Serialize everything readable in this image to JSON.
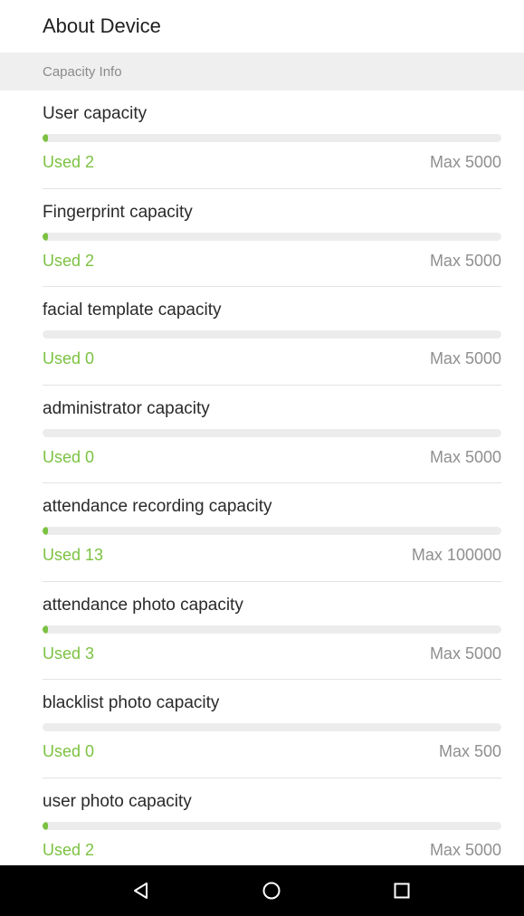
{
  "header": {
    "title": "About Device"
  },
  "section": {
    "title": "Capacity Info"
  },
  "colors": {
    "accent": "#7cc242",
    "track": "#ececec",
    "navbar": "#000000"
  },
  "items": [
    {
      "label": "User capacity",
      "used_label": "Used 2",
      "max_label": "Max 5000",
      "used": 2,
      "max": 5000
    },
    {
      "label": "Fingerprint capacity",
      "used_label": "Used 2",
      "max_label": "Max 5000",
      "used": 2,
      "max": 5000
    },
    {
      "label": "facial template capacity",
      "used_label": "Used 0",
      "max_label": "Max 5000",
      "used": 0,
      "max": 5000
    },
    {
      "label": "administrator capacity",
      "used_label": "Used 0",
      "max_label": "Max 5000",
      "used": 0,
      "max": 5000
    },
    {
      "label": "attendance recording capacity",
      "used_label": "Used 13",
      "max_label": "Max 100000",
      "used": 13,
      "max": 100000
    },
    {
      "label": "attendance photo capacity",
      "used_label": "Used 3",
      "max_label": "Max 5000",
      "used": 3,
      "max": 5000
    },
    {
      "label": "blacklist photo capacity",
      "used_label": "Used 0",
      "max_label": "Max 500",
      "used": 0,
      "max": 500
    },
    {
      "label": "user photo capacity",
      "used_label": "Used 2",
      "max_label": "Max 5000",
      "used": 2,
      "max": 5000
    }
  ],
  "navbar": {
    "icons": [
      "back-icon",
      "home-icon",
      "recents-icon"
    ]
  }
}
